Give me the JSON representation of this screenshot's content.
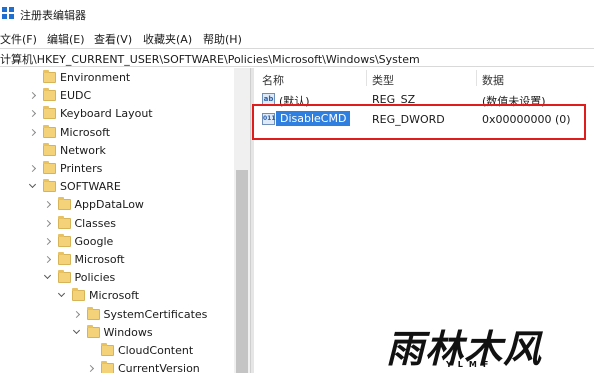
{
  "window": {
    "title": "注册表编辑器"
  },
  "menu": [
    "文件(F)",
    "编辑(E)",
    "查看(V)",
    "收藏夹(A)",
    "帮助(H)"
  ],
  "address": {
    "path": "计算机\\HKEY_CURRENT_USER\\SOFTWARE\\Policies\\Microsoft\\Windows\\System"
  },
  "tree": {
    "items": [
      {
        "label": "Environment",
        "expander": "none"
      },
      {
        "label": "EUDC",
        "expander": "collapsed"
      },
      {
        "label": "Keyboard Layout",
        "expander": "collapsed"
      },
      {
        "label": "Microsoft",
        "expander": "collapsed"
      },
      {
        "label": "Network",
        "expander": "none"
      },
      {
        "label": "Printers",
        "expander": "collapsed"
      },
      {
        "label": "SOFTWARE",
        "expander": "expanded"
      },
      {
        "label": "AppDataLow",
        "expander": "collapsed"
      },
      {
        "label": "Classes",
        "expander": "collapsed"
      },
      {
        "label": "Google",
        "expander": "collapsed"
      },
      {
        "label": "Microsoft",
        "expander": "collapsed"
      },
      {
        "label": "Policies",
        "expander": "expanded"
      },
      {
        "label": "Microsoft",
        "expander": "expanded"
      },
      {
        "label": "SystemCertificates",
        "expander": "collapsed"
      },
      {
        "label": "Windows",
        "expander": "expanded"
      },
      {
        "label": "CloudContent",
        "expander": "none"
      },
      {
        "label": "CurrentVersion",
        "expander": "collapsed"
      }
    ]
  },
  "list": {
    "columns": [
      "名称",
      "类型",
      "数据"
    ],
    "rows": [
      {
        "name": "(默认)",
        "type": "REG_SZ",
        "data": "(数值未设置)",
        "icon": "string-value-icon"
      },
      {
        "name": "DisableCMD",
        "type": "REG_DWORD",
        "data": "0x00000000 (0)",
        "icon": "dword-value-icon",
        "selected": true
      }
    ]
  },
  "watermark": {
    "main": "雨林木风",
    "sub": "YLMF"
  },
  "colors": {
    "selection": "#2f7fe0",
    "highlight": "#e01d1d",
    "folder": "#f3d27a"
  }
}
